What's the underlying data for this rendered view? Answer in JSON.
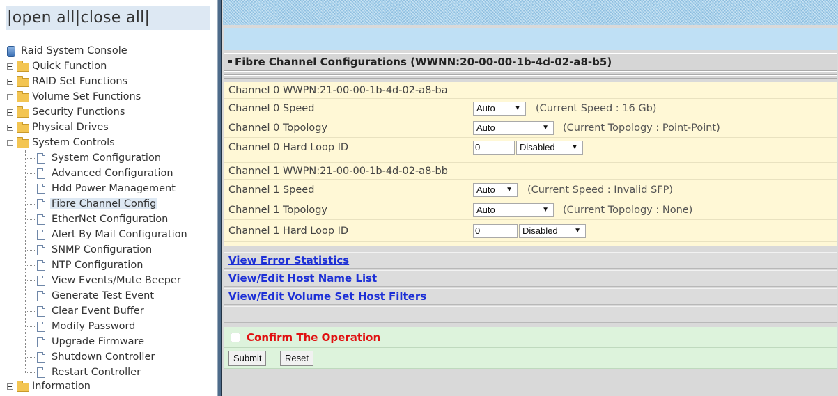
{
  "left": {
    "open_all": "open all",
    "close_all": "close all",
    "root": "Raid System Console",
    "folders": [
      {
        "label": "Quick Function"
      },
      {
        "label": "RAID Set Functions"
      },
      {
        "label": "Volume Set Functions"
      },
      {
        "label": "Security Functions"
      },
      {
        "label": "Physical Drives"
      },
      {
        "label": "System Controls"
      }
    ],
    "system_controls_items": [
      "System Configuration",
      "Advanced Configuration",
      "Hdd Power Management",
      "Fibre Channel Config",
      "EtherNet Configuration",
      "Alert By Mail Configuration",
      "SNMP Configuration",
      "NTP Configuration",
      "View Events/Mute Beeper",
      "Generate Test Event",
      "Clear Event Buffer",
      "Modify Password",
      "Upgrade Firmware",
      "Shutdown Controller",
      "Restart Controller"
    ],
    "information": "Information"
  },
  "main": {
    "title": "Fibre Channel Configurations (WWNN:20-00-00-1b-4d-02-a8-b5)",
    "ch0": {
      "wwpn": "Channel 0 WWPN:21-00-00-1b-4d-02-a8-ba",
      "speed_label": "Channel 0 Speed",
      "speed_value": "Auto",
      "speed_note": "(Current Speed : 16 Gb)",
      "topology_label": "Channel 0 Topology",
      "topology_value": "Auto",
      "topology_note": "(Current Topology : Point-Point)",
      "loop_label": "Channel 0 Hard Loop ID",
      "loop_value": "0",
      "loop_mode": "Disabled"
    },
    "ch1": {
      "wwpn": "Channel 1 WWPN:21-00-00-1b-4d-02-a8-bb",
      "speed_label": "Channel 1 Speed",
      "speed_value": "Auto",
      "speed_note": "(Current Speed : Invalid SFP)",
      "topology_label": "Channel 1 Topology",
      "topology_value": "Auto",
      "topology_note": "(Current Topology : None)",
      "loop_label": "Channel 1 Hard Loop ID",
      "loop_value": "0",
      "loop_mode": "Disabled"
    },
    "links": {
      "error_stats": "View Error Statistics",
      "host_names": "View/Edit Host Name List",
      "host_filters": "View/Edit Volume Set Host Filters"
    },
    "confirm": "Confirm The Operation",
    "submit": "Submit",
    "reset": "Reset"
  }
}
